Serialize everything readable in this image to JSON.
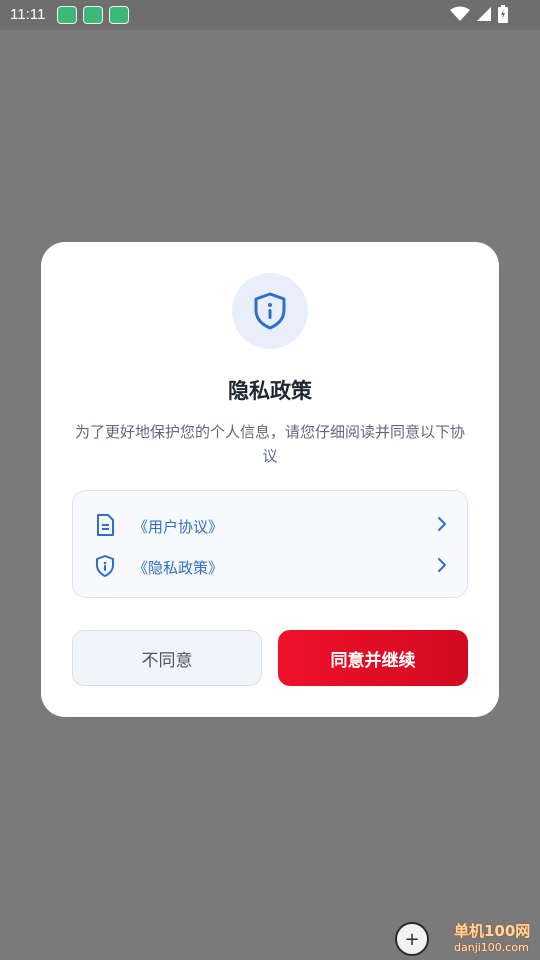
{
  "status_bar": {
    "time": "11:11",
    "notification_icons": [
      "app-icon",
      "app-icon",
      "app-icon"
    ],
    "system_icons": [
      "wifi-icon",
      "signal-icon",
      "battery-icon"
    ]
  },
  "dialog": {
    "title": "隐私政策",
    "description": "为了更好地保护您的个人信息，请您仔细阅读并同意以下协议",
    "links": [
      {
        "label": "《用户协议》",
        "icon": "document-icon"
      },
      {
        "label": "《隐私政策》",
        "icon": "shield-icon"
      }
    ],
    "disagree_label": "不同意",
    "agree_label": "同意并继续"
  },
  "watermark": {
    "text": "单机100网",
    "url": "danji100.com"
  },
  "colors": {
    "accent_red": "#e60f25",
    "link_blue": "#2f6fc9",
    "overlay": "#7a7a7a"
  }
}
